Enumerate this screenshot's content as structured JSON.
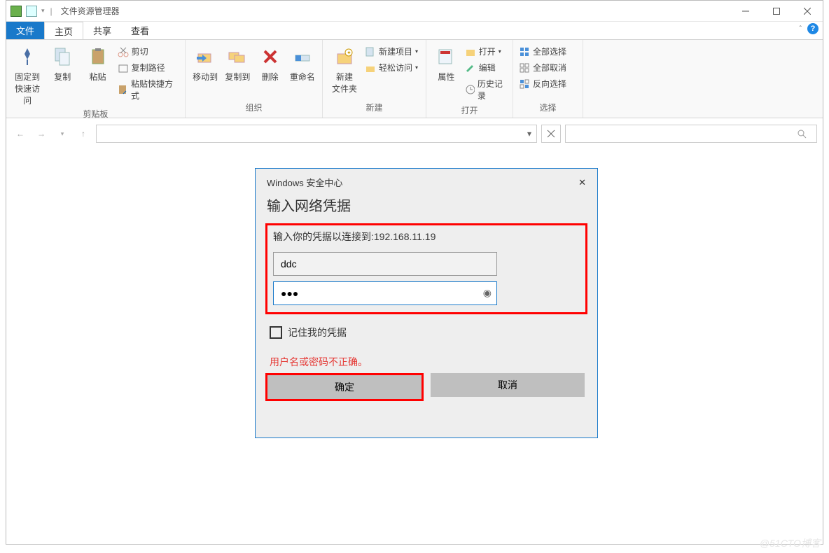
{
  "window": {
    "title": "文件资源管理器"
  },
  "tabs": {
    "file": "文件",
    "home": "主页",
    "share": "共享",
    "view": "查看"
  },
  "ribbon": {
    "clipboard": {
      "label": "剪贴板",
      "pin": "固定到\n快速访问",
      "copy": "复制",
      "paste": "粘贴",
      "cut": "剪切",
      "copy_path": "复制路径",
      "paste_shortcut": "粘贴快捷方式"
    },
    "organize": {
      "label": "组织",
      "move_to": "移动到",
      "copy_to": "复制到",
      "delete": "删除",
      "rename": "重命名"
    },
    "new": {
      "label": "新建",
      "new_folder": "新建\n文件夹",
      "new_item": "新建项目",
      "easy_access": "轻松访问"
    },
    "open": {
      "label": "打开",
      "properties": "属性",
      "open": "打开",
      "edit": "编辑",
      "history": "历史记录"
    },
    "select": {
      "label": "选择",
      "select_all": "全部选择",
      "select_none": "全部取消",
      "invert": "反向选择"
    }
  },
  "dialog": {
    "header": "Windows 安全中心",
    "title": "输入网络凭据",
    "prompt": "输入你的凭据以连接到:192.168.11.19",
    "username": "ddc",
    "password": "●●●",
    "remember": "记住我的凭据",
    "error": "用户名或密码不正确。",
    "ok": "确定",
    "cancel": "取消"
  },
  "watermark": "@51CTO博客"
}
